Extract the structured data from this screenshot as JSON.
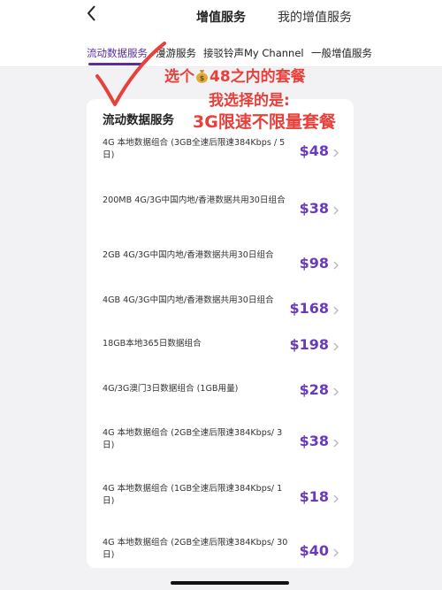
{
  "header": {
    "title": "增值服务",
    "mine": "我的增值服务"
  },
  "tabs": [
    {
      "label": "流动数据服务",
      "active": true
    },
    {
      "label": "漫游服务",
      "active": false
    },
    {
      "label": "接驳铃声My Channel",
      "active": false
    },
    {
      "label": "一般增值服务",
      "active": false
    }
  ],
  "annotations": {
    "line1_a": "选个",
    "line1_b": "48之内的套餐",
    "line2": "我选择的是:",
    "line3": "3G限速不限量套餐"
  },
  "section": {
    "title": "流动数据服务"
  },
  "plans": [
    {
      "desc": "4G 本地数据组合 (3GB全速后限速384Kbps / 5日)",
      "price": "$48"
    },
    {
      "desc": "200MB 4G/3G中国内地/香港数据共用30日组合",
      "price": "$38"
    },
    {
      "desc": "2GB 4G/3G中国内地/香港数据共用30日组合",
      "price": "$98"
    },
    {
      "desc": "4GB 4G/3G中国内地/香港数据共用30日组合",
      "price": "$168"
    },
    {
      "desc": "18GB本地365日数据组合",
      "price": "$198"
    },
    {
      "desc": "4G/3G澳门3日数据组合 (1GB用量)",
      "price": "$28"
    },
    {
      "desc": "4G 本地数据组合 (2GB全速后限速384Kbps/ 3日)",
      "price": "$38"
    },
    {
      "desc": "4G 本地数据组合 (1GB全速后限速384Kbps/ 1日)",
      "price": "$18"
    },
    {
      "desc": "4G 本地数据组合 (2GB全速后限速384Kbps/ 30日)",
      "price": "$40"
    }
  ],
  "colors": {
    "accent": "#5a2ca0",
    "price": "#6a3ab8",
    "annotation": "#e8403a"
  }
}
